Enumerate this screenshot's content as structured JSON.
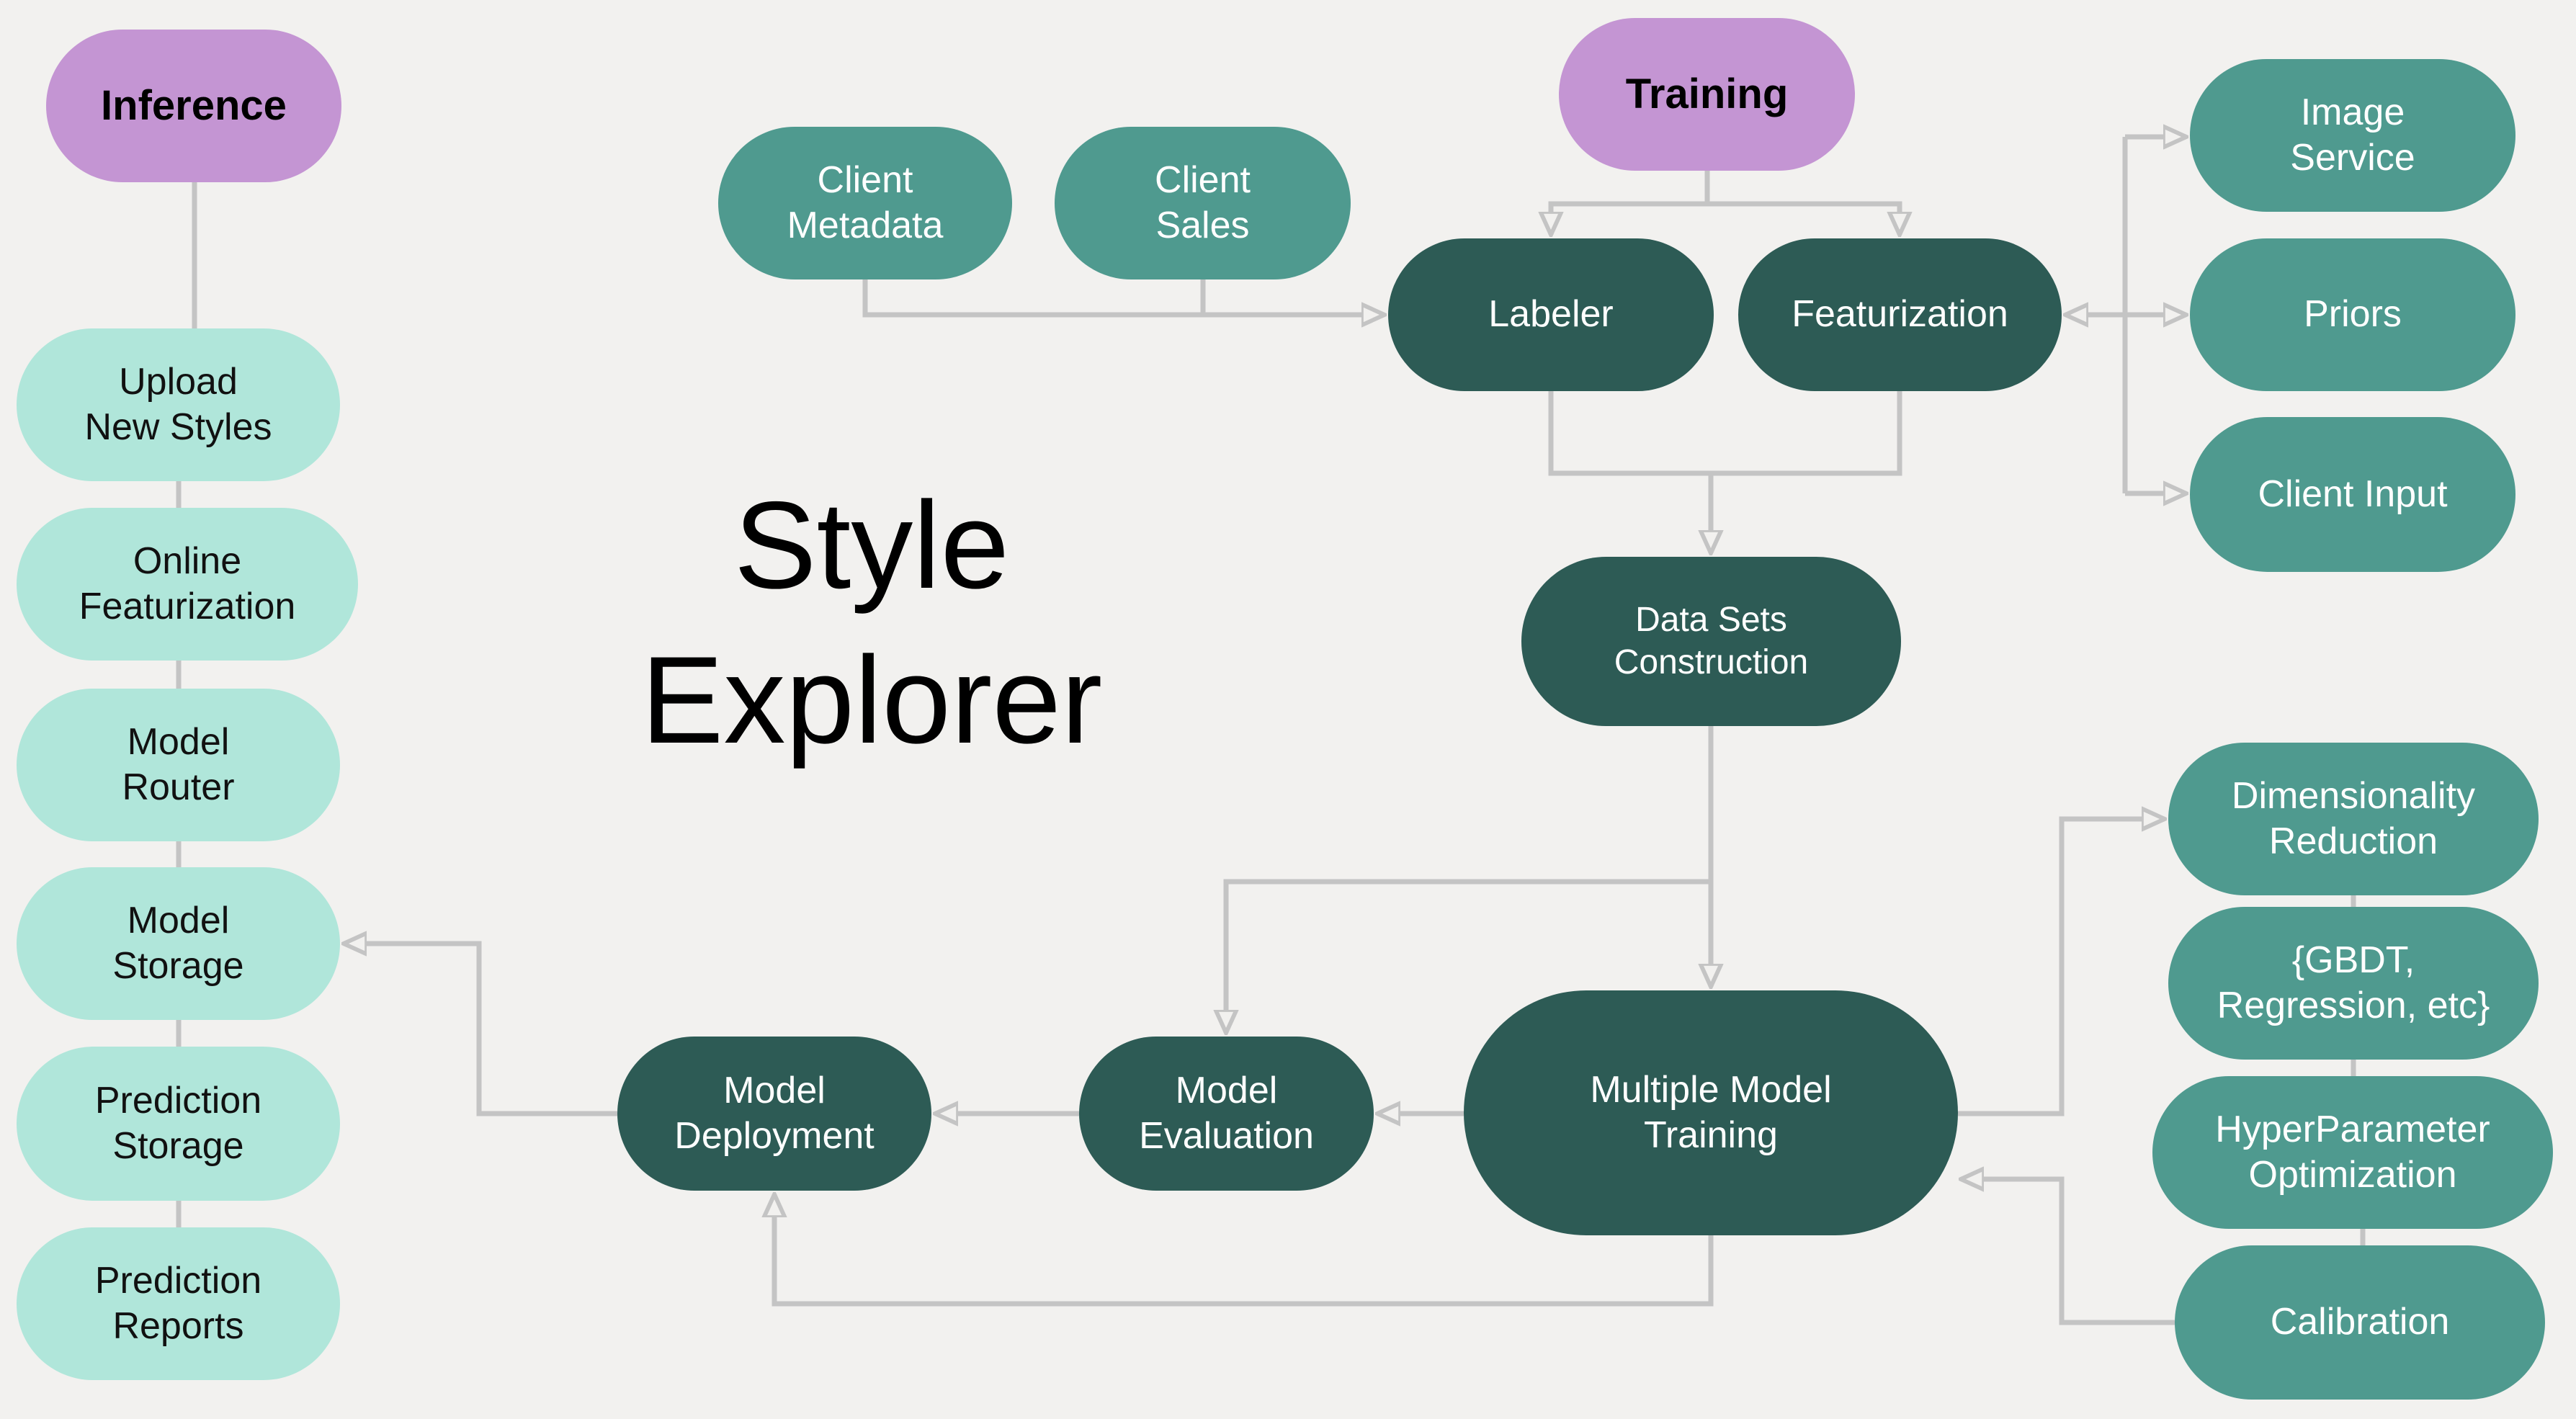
{
  "title": "Style\nExplorer",
  "colors": {
    "background": "#f2f1ef",
    "category": "#c495d3",
    "inference_step": "#b0e6da",
    "input_source": "#4f9a8f",
    "training_step": "#2d5b55",
    "connector": "#c4c4c4"
  },
  "inference": {
    "header": "Inference",
    "steps": [
      "Upload\nNew Styles",
      "Online\nFeaturization",
      "Model\nRouter",
      "Model\nStorage",
      "Prediction\nStorage",
      "Prediction\nReports"
    ]
  },
  "training": {
    "header": "Training",
    "sources": [
      "Client\nMetadata",
      "Client\nSales"
    ],
    "labeler": "Labeler",
    "featurization": "Featurization",
    "feature_sources": [
      "Image\nService",
      "Priors",
      "Client Input"
    ],
    "datasets": "Data Sets\nConstruction",
    "multi_training": "Multiple Model\nTraining",
    "evaluation": "Model\nEvaluation",
    "deployment": "Model\nDeployment",
    "training_steps": [
      "Dimensionality\nReduction",
      "{GBDT,\nRegression, etc}",
      "HyperParameter\nOptimization",
      "Calibration"
    ]
  }
}
